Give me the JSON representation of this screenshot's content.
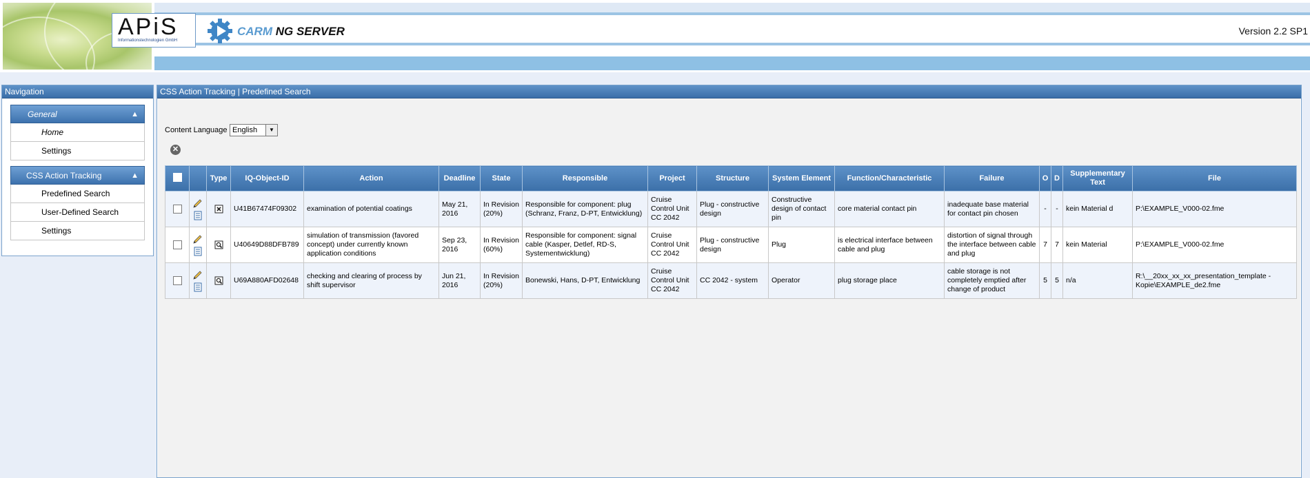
{
  "header": {
    "logo_text": "APiS",
    "logo_subtitle": "Informationstechnologien GmbH",
    "product_name_part1": "CARM",
    "product_name_part2": "NG SERVER",
    "version": "Version 2.2 SP1"
  },
  "navigation": {
    "title": "Navigation",
    "groups": [
      {
        "label": "General",
        "items": [
          {
            "label": "Home"
          },
          {
            "label": "Settings"
          }
        ]
      },
      {
        "label": "CSS Action Tracking",
        "items": [
          {
            "label": "Predefined Search"
          },
          {
            "label": "User-Defined Search"
          },
          {
            "label": "Settings"
          }
        ]
      }
    ]
  },
  "main": {
    "title": "CSS Action Tracking | Predefined Search",
    "content_language_label": "Content Language",
    "content_language_value": "English",
    "table": {
      "columns": [
        "",
        "",
        "Type",
        "IQ-Object-ID",
        "Action",
        "Deadline",
        "State",
        "Responsible",
        "Project",
        "Structure",
        "System Element",
        "Function/Characteristic",
        "Failure",
        "O",
        "D",
        "Supplementary Text",
        "File"
      ],
      "rows": [
        {
          "object_id": "U41B67474F09302",
          "action": "examination of potential coatings",
          "deadline": "May 21, 2016",
          "state": "In Revision (20%)",
          "responsible": "Responsible for component: plug (Schranz, Franz, D-PT, Entwicklung)",
          "project": "Cruise Control Unit CC 2042",
          "structure": "Plug - constructive design",
          "system_element": "Constructive design of contact pin",
          "function": "core material contact pin",
          "failure": "inadequate base material for contact pin chosen",
          "o": "-",
          "d": "-",
          "supplementary": "kein Material d",
          "file": "P:\\EXAMPLE_V000-02.fme",
          "type_icon": "cancelled-action-icon"
        },
        {
          "object_id": "U40649D88DFB789",
          "action": "simulation of transmission (favored concept) under currently known application conditions",
          "deadline": "Sep 23, 2016",
          "state": "In Revision (60%)",
          "responsible": "Responsible for component: signal cable (Kasper, Detlef, RD-S, Systementwicklung)",
          "project": "Cruise Control Unit CC 2042",
          "structure": "Plug - constructive design",
          "system_element": "Plug",
          "function": "is electrical interface between cable and plug",
          "failure": "distortion of signal through the interface between cable and plug",
          "o": "7",
          "d": "7",
          "supplementary": "kein Material",
          "file": "P:\\EXAMPLE_V000-02.fme",
          "type_icon": "detection-action-icon"
        },
        {
          "object_id": "U69A880AFD02648",
          "action": "checking and clearing of process by shift supervisor",
          "deadline": "Jun 21, 2016",
          "state": "In Revision (20%)",
          "responsible": "Bonewski, Hans, D-PT, Entwicklung",
          "project": "Cruise Control Unit CC 2042",
          "structure": "CC 2042 - system",
          "system_element": "Operator",
          "function": "plug storage place",
          "failure": "cable storage is not completely emptied after change of product",
          "o": "5",
          "d": "5",
          "supplementary": "n/a",
          "file": "R:\\__20xx_xx_xx_presentation_template - Kopie\\EXAMPLE_de2.fme",
          "type_icon": "detection-action-icon"
        }
      ]
    }
  }
}
